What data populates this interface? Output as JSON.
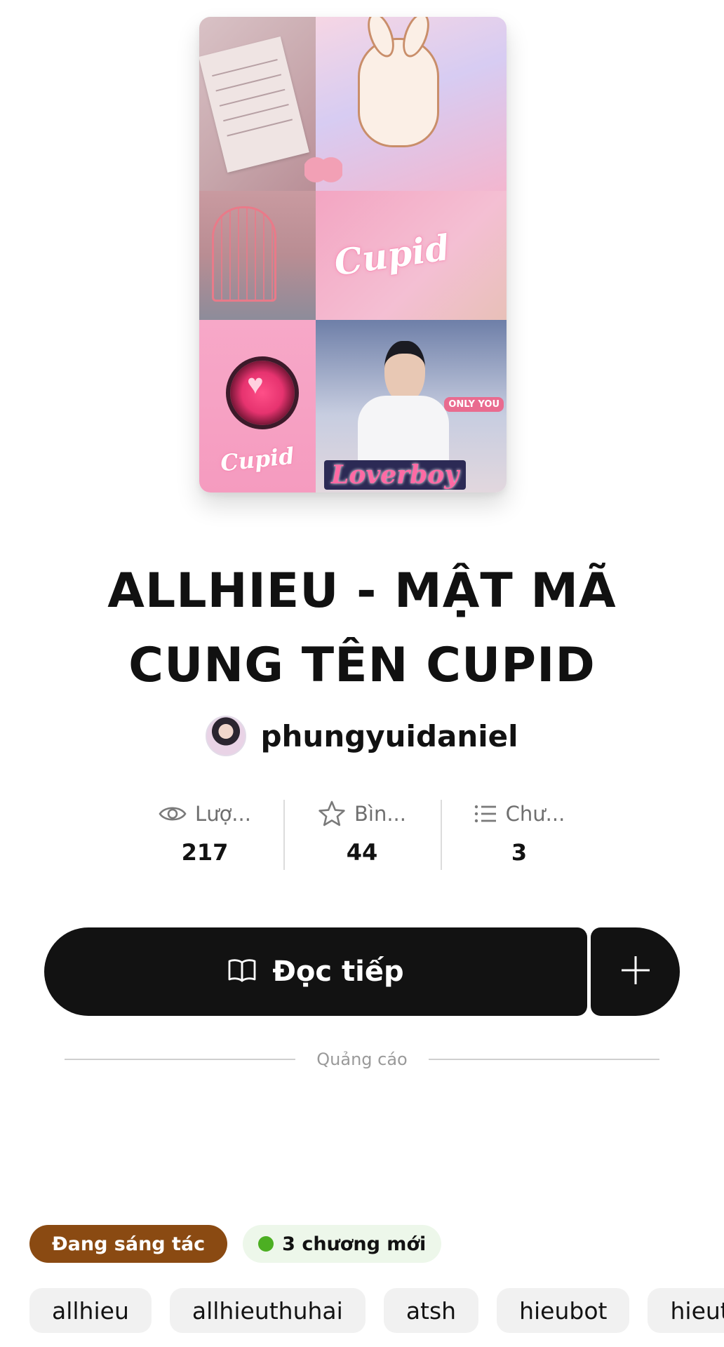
{
  "story": {
    "cover_texts": [
      "Cupid",
      "Cupid",
      "Loverboy",
      "ONLY YOU"
    ],
    "title": "ALLHIEU - MẬT MÃ CUNG TÊN CUPID",
    "author": "phungyuidaniel"
  },
  "stats": [
    {
      "icon": "eye-icon",
      "label": "Lượ...",
      "value": "217"
    },
    {
      "icon": "star-icon",
      "label": "Bìn...",
      "value": "44"
    },
    {
      "icon": "list-icon",
      "label": "Chư...",
      "value": "3"
    }
  ],
  "actions": {
    "read_label": "Đọc tiếp",
    "read_icon": "open-book-icon",
    "add_icon": "plus-icon"
  },
  "ad": {
    "label": "Quảng cáo"
  },
  "status": {
    "writing": "Đang sáng tác",
    "new_chapters": "3 chương mới"
  },
  "tags": [
    "allhieu",
    "allhieuthuhai",
    "atsh",
    "hieubot",
    "hieuth"
  ],
  "colors": {
    "button_bg": "#121212",
    "writing_badge": "#8a4a12",
    "new_badge_bg": "#edf7ea",
    "new_dot": "#4caf22"
  }
}
